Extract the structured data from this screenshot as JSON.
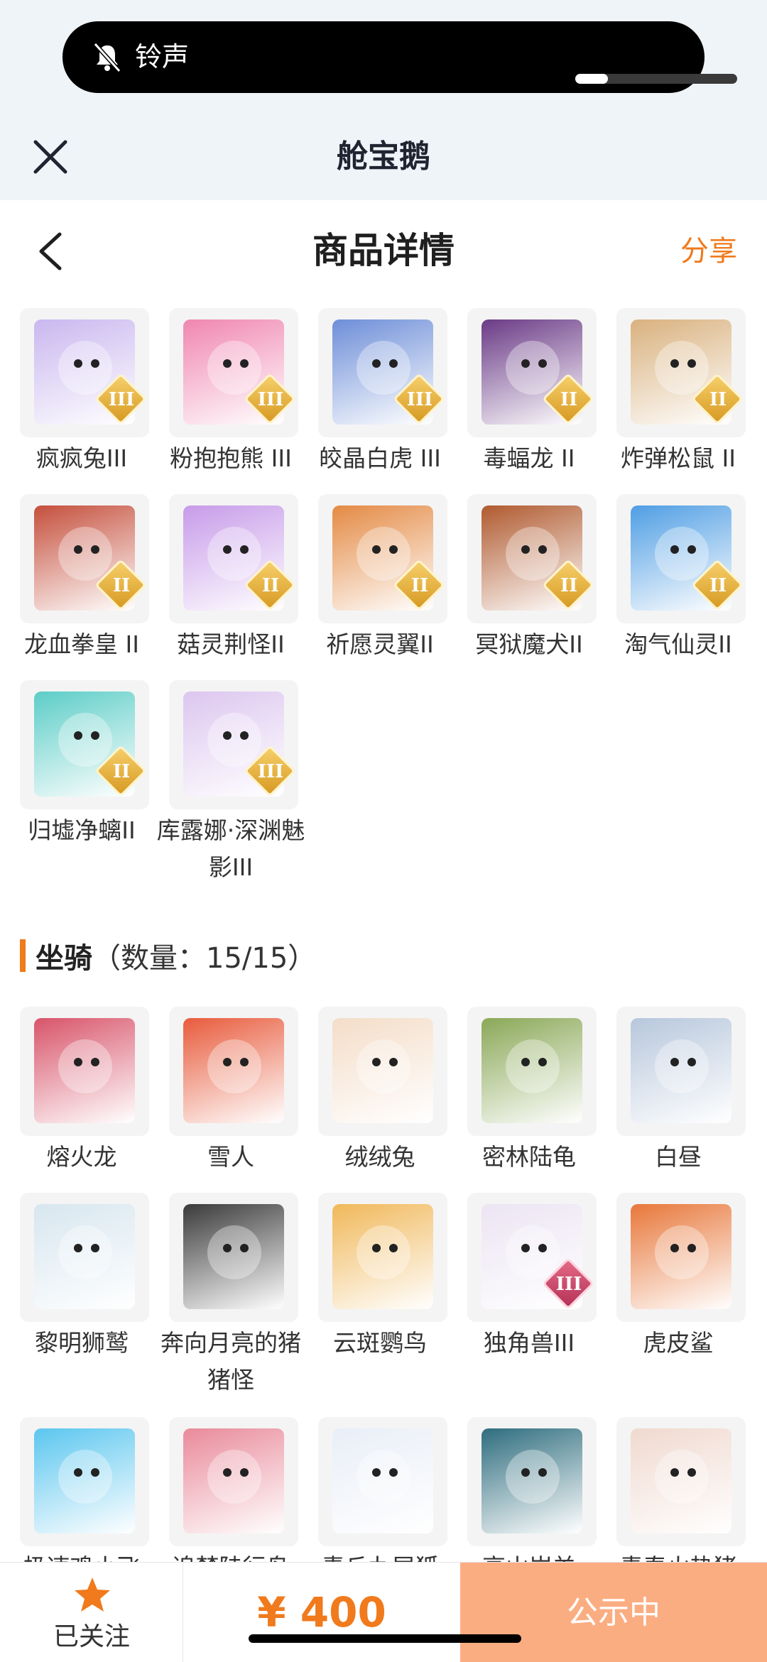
{
  "status": {
    "ringer_label": "铃声",
    "ringer_volume_fraction": 0.2
  },
  "header": {
    "title": "舱宝鹅"
  },
  "page": {
    "title": "商品详情",
    "share_label": "分享"
  },
  "pets": [
    {
      "name": "疯疯兔III",
      "tier": "III",
      "color": "#c9b7ef"
    },
    {
      "name": "粉抱抱熊 III",
      "tier": "III",
      "color": "#f086b0"
    },
    {
      "name": "皎晶白虎 III",
      "tier": "III",
      "color": "#6d8ed8"
    },
    {
      "name": "毒蝠龙 II",
      "tier": "II",
      "color": "#6a3a86"
    },
    {
      "name": "炸弹松鼠 II",
      "tier": "II",
      "color": "#d9b17e"
    },
    {
      "name": "龙血拳皇 II",
      "tier": "II",
      "color": "#c54f3c"
    },
    {
      "name": "菇灵荆怪II",
      "tier": "II",
      "color": "#c79be9"
    },
    {
      "name": "祈愿灵翼II",
      "tier": "II",
      "color": "#e48a44"
    },
    {
      "name": "冥狱魔犬II",
      "tier": "II",
      "color": "#b05a2f"
    },
    {
      "name": "淘气仙灵II",
      "tier": "II",
      "color": "#4f9ee4"
    },
    {
      "name": "归墟净螭II",
      "tier": "II",
      "color": "#5ccdc7"
    },
    {
      "name": "库露娜·深渊魅影III",
      "tier": "III",
      "color": "#dcc6ef"
    }
  ],
  "mounts_section": {
    "title": "坐骑",
    "count": "（数量：15/15）"
  },
  "mounts": [
    {
      "name": "熔火龙",
      "tier": "",
      "color": "#d8546a"
    },
    {
      "name": "雪人",
      "tier": "",
      "color": "#e85b3c"
    },
    {
      "name": "绒绒兔",
      "tier": "",
      "color": "#f4ddc8"
    },
    {
      "name": "密林陆龟",
      "tier": "",
      "color": "#8aa857"
    },
    {
      "name": "白昼",
      "tier": "",
      "color": "#b7c7dc"
    },
    {
      "name": "黎明狮鹫",
      "tier": "",
      "color": "#d7e6ef"
    },
    {
      "name": "奔向月亮的猪猪怪",
      "tier": "",
      "color": "#3a3a3a"
    },
    {
      "name": "云斑鹦鸟",
      "tier": "",
      "color": "#f0b85a"
    },
    {
      "name": "独角兽III",
      "tier": "III",
      "color": "#ece4f3"
    },
    {
      "name": "虎皮鲨",
      "tier": "",
      "color": "#e8773a"
    },
    {
      "name": "极速鸡小飞",
      "tier": "",
      "color": "#5bc6ef"
    },
    {
      "name": "追梦陆行鸟",
      "tier": "",
      "color": "#e98a9a"
    },
    {
      "name": "青丘九尾狐",
      "tier": "",
      "color": "#e9eef7"
    },
    {
      "name": "高山岩羊",
      "tier": "",
      "color": "#2e6d7e"
    },
    {
      "name": "青春火热猪",
      "tier": "",
      "color": "#f0d9cf"
    }
  ],
  "bottom": {
    "follow_label": "已关注",
    "price": "¥ 400",
    "status_button": "公示中"
  },
  "colors": {
    "accent": "#f07a1c",
    "status_button": "#fbad82"
  }
}
